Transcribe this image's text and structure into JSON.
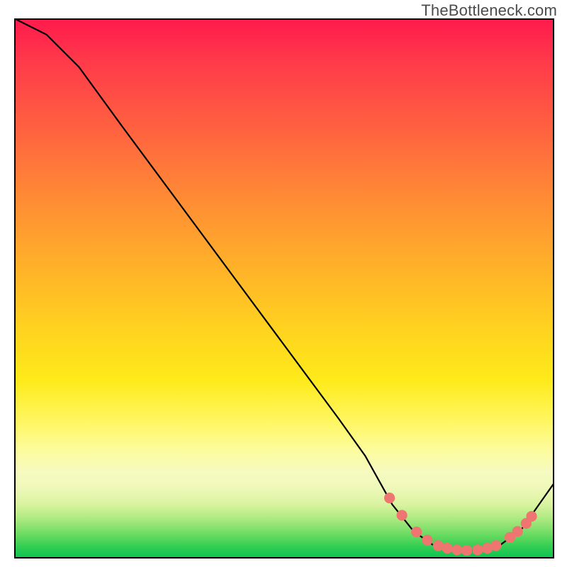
{
  "watermark": "TheBottleneck.com",
  "chart_data": {
    "type": "line",
    "title": "",
    "xlabel": "",
    "ylabel": "",
    "xlim": [
      0,
      100
    ],
    "ylim": [
      0,
      100
    ],
    "grid": false,
    "background": "rainbow-gradient-vertical",
    "series": [
      {
        "name": "curve",
        "x": [
          0,
          6,
          12,
          20,
          30,
          40,
          50,
          60,
          65,
          70,
          74,
          78,
          82,
          86,
          90,
          94,
          100
        ],
        "y": [
          100,
          97,
          91,
          80,
          66.5,
          53,
          39.5,
          26,
          19,
          10,
          5,
          2.2,
          1.5,
          1.5,
          2.5,
          5.5,
          14
        ]
      }
    ],
    "markers": {
      "name": "dots-near-minimum",
      "points_xy": [
        [
          69.5,
          11.2
        ],
        [
          71.8,
          8.0
        ],
        [
          74.5,
          4.9
        ],
        [
          76.5,
          3.4
        ],
        [
          78.5,
          2.4
        ],
        [
          80.2,
          1.9
        ],
        [
          82.0,
          1.6
        ],
        [
          83.8,
          1.5
        ],
        [
          85.8,
          1.6
        ],
        [
          87.6,
          1.9
        ],
        [
          89.2,
          2.4
        ],
        [
          91.8,
          3.9
        ],
        [
          93.2,
          5.0
        ],
        [
          94.8,
          6.5
        ],
        [
          95.8,
          7.8
        ]
      ]
    }
  },
  "colors": {
    "gradient_top": "#ff1a4d",
    "gradient_mid": "#ffd41f",
    "gradient_bottom": "#09c450",
    "curve": "#000000",
    "marker": "#ef7670",
    "border": "#000000",
    "watermark_text": "#4b4b4b"
  }
}
